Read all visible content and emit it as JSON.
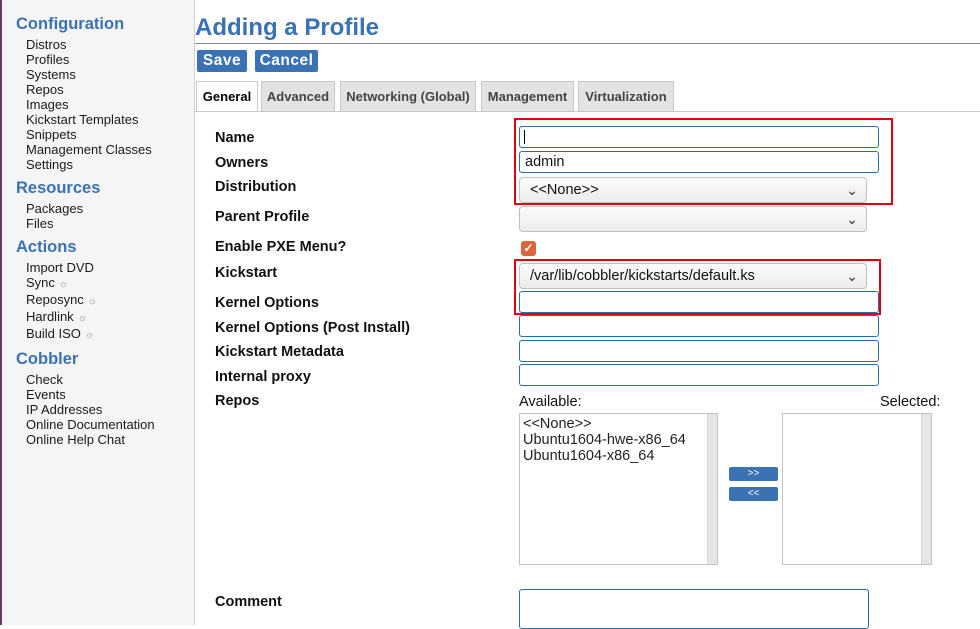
{
  "sidebar": {
    "configuration": {
      "title": "Configuration",
      "items": [
        "Distros",
        "Profiles",
        "Systems",
        "Repos",
        "Images",
        "Kickstart Templates",
        "Snippets",
        "Management Classes",
        "Settings"
      ]
    },
    "resources": {
      "title": "Resources",
      "items": [
        "Packages",
        "Files"
      ]
    },
    "actions": {
      "title": "Actions",
      "items": [
        "Import DVD",
        "Sync",
        "Reposync",
        "Hardlink",
        "Build ISO"
      ]
    },
    "cobbler": {
      "title": "Cobbler",
      "items": [
        "Check",
        "Events",
        "IP Addresses",
        "Online Documentation",
        "Online Help Chat"
      ]
    },
    "gear_glyph": "☼"
  },
  "page": {
    "title": "Adding a Profile"
  },
  "buttons": {
    "save": "Save",
    "cancel": "Cancel"
  },
  "tabs": [
    "General",
    "Advanced",
    "Networking (Global)",
    "Management",
    "Virtualization"
  ],
  "form": {
    "name": {
      "label": "Name",
      "value": ""
    },
    "owners": {
      "label": "Owners",
      "value": "admin"
    },
    "distribution": {
      "label": "Distribution",
      "value": "<<None>>"
    },
    "parent_profile": {
      "label": "Parent Profile",
      "value": ""
    },
    "enable_pxe": {
      "label": "Enable PXE Menu?",
      "checked": true
    },
    "kickstart": {
      "label": "Kickstart",
      "value": "/var/lib/cobbler/kickstarts/default.ks"
    },
    "kernel_options": {
      "label": "Kernel Options",
      "value": ""
    },
    "kernel_options_post": {
      "label": "Kernel Options (Post Install)",
      "value": ""
    },
    "kickstart_metadata": {
      "label": "Kickstart Metadata",
      "value": ""
    },
    "internal_proxy": {
      "label": "Internal proxy",
      "value": ""
    },
    "repos": {
      "label": "Repos",
      "available_label": "Available:",
      "selected_label": "Selected:",
      "available": [
        "<<None>>",
        "Ubuntu1604-hwe-x86_64",
        "Ubuntu1604-x86_64"
      ],
      "selected": [],
      "add_label": ">>",
      "remove_label": "<<"
    },
    "comment": {
      "label": "Comment",
      "value": ""
    }
  },
  "colors": {
    "accent": "#3a72b3",
    "highlight": "#e00010",
    "checkbox": "#d9663c"
  }
}
